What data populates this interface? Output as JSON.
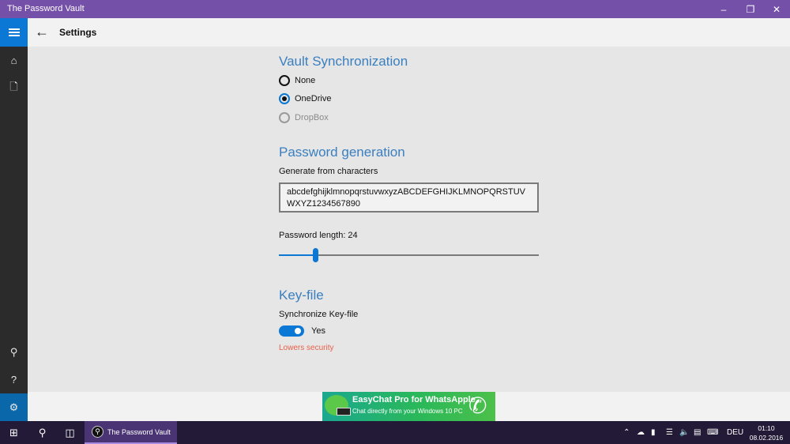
{
  "window": {
    "title": "The Password Vault",
    "minimize_icon": "minimize-icon",
    "maximize_icon": "restore-icon",
    "close_icon": "close-icon"
  },
  "header": {
    "menu_icon": "hamburger-icon",
    "back_icon": "back-arrow-icon",
    "title": "Settings"
  },
  "sidebar": {
    "top_items": [
      {
        "name": "home",
        "icon": "home-icon"
      },
      {
        "name": "vault",
        "icon": "locked-file-icon"
      }
    ],
    "bottom_items": [
      {
        "name": "key",
        "icon": "key-icon"
      },
      {
        "name": "help",
        "icon": "help-icon"
      },
      {
        "name": "settings",
        "icon": "gear-icon",
        "active": true
      }
    ]
  },
  "vault_sync": {
    "title": "Vault Synchronization",
    "options": [
      {
        "label": "None",
        "checked": false,
        "disabled": false
      },
      {
        "label": "OneDrive",
        "checked": true,
        "disabled": false
      },
      {
        "label": "DropBox",
        "checked": false,
        "disabled": true
      }
    ]
  },
  "password_generation": {
    "title": "Password generation",
    "chars_label": "Generate from characters",
    "chars_value": "abcdefghijklmnopqrstuvwxyzABCDEFGHIJKLMNOPQRSTUVWXYZ1234567890",
    "length_label": "Password length: 24",
    "length_value": 24,
    "slider_fraction": 0.14
  },
  "key_file": {
    "title": "Key-file",
    "sync_label": "Synchronize Key-file",
    "toggle_label": "Yes",
    "toggle_on": true,
    "warning": "Lowers security"
  },
  "ad": {
    "line1": "EasyChat Pro for WhatsApple",
    "line2": "Chat directly from your Windows 10 PC"
  },
  "taskbar": {
    "app_label": "The Password Vault",
    "language": "DEU",
    "time": "01:10",
    "date": "08.02.2016"
  },
  "colors": {
    "titlebar": "#7550a8",
    "accent": "#0a78d4",
    "section_title": "#3a7fbf",
    "warning": "#e8604a",
    "sidebar": "#2b2b2b",
    "taskbar": "#221a36"
  }
}
